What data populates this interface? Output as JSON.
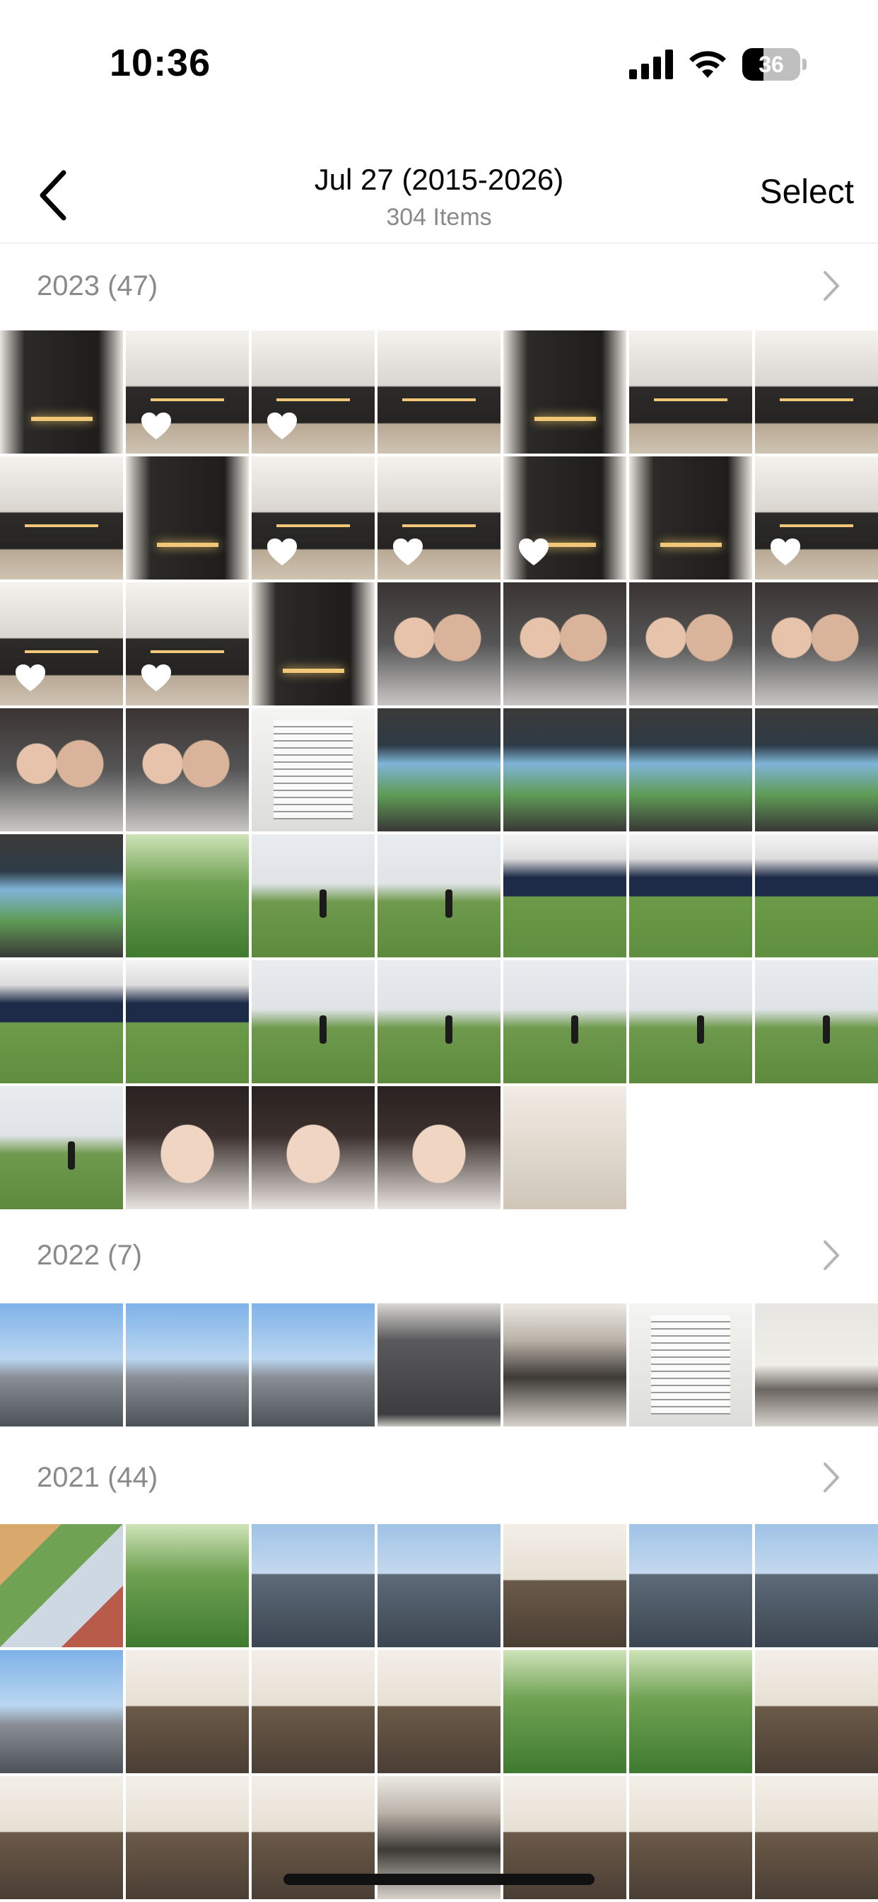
{
  "status_bar": {
    "time": "10:36",
    "battery_level": "36",
    "icons": [
      "signal-icon",
      "wifi-icon",
      "battery-icon"
    ]
  },
  "nav": {
    "back_icon": "chevron-left-icon",
    "title": "Jul 27 (2015-2026)",
    "subtitle": "304 Items",
    "select_label": "Select"
  },
  "sections": [
    {
      "title": "2023 (47)",
      "icon": "chevron-right-icon"
    },
    {
      "title": "2022 (7)",
      "icon": "chevron-right-icon"
    },
    {
      "title": "2021 (44)",
      "icon": "chevron-right-icon"
    }
  ],
  "colors": {
    "secondary_text": "#8a8a8e",
    "divider": "#e2e2e2",
    "favorite_heart": "#ffffff"
  }
}
